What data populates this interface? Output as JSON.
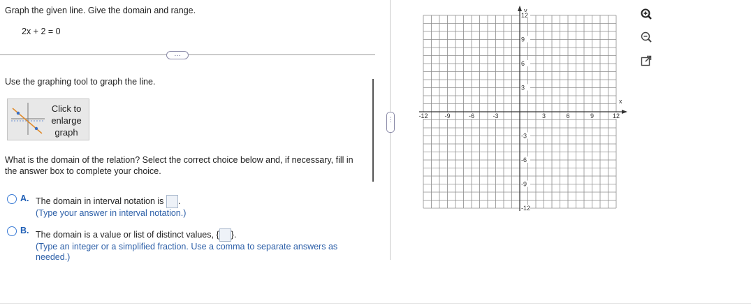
{
  "question": {
    "prompt": "Graph the given line. Give the domain and range.",
    "equation": "2x + 2 = 0"
  },
  "instructions": "Use the graphing tool to graph the line.",
  "enlarge": {
    "line1": "Click to",
    "line2": "enlarge",
    "line3": "graph"
  },
  "more_button": "…",
  "divider_handle": "⋮",
  "domain_question": {
    "line1": "What is the domain of the relation? Select the correct choice below and, if necessary, fill in",
    "line2": "the answer box to complete your choice."
  },
  "choices": [
    {
      "letter": "A.",
      "text_before": "The domain in interval notation is",
      "text_after": ".",
      "hint": "(Type your answer in interval notation.)"
    },
    {
      "letter": "B.",
      "text_before": "The domain is a value or list of distinct values,",
      "open_brace": "{",
      "close_brace": "}",
      "text_after": ".",
      "hint_line1": "(Type an integer or a simplified fraction. Use a comma to separate answers as",
      "hint_line2": "needed.)"
    }
  ],
  "graph": {
    "x_axis_label": "x",
    "y_axis_label": "y",
    "x_ticks": [
      "-12",
      "-9",
      "-6",
      "-3",
      "3",
      "6",
      "9",
      "12"
    ],
    "y_ticks": [
      "12",
      "9",
      "6",
      "3",
      "-3",
      "-6",
      "-9",
      "-12"
    ],
    "range": [
      -12,
      12
    ],
    "grid": true
  },
  "tools": [
    "zoom-in-icon",
    "zoom-out-icon",
    "open-new-window-icon"
  ],
  "colors": {
    "accent": "#1f5fb6",
    "grid": "#9a9a9a",
    "radio": "#3a7bd5"
  }
}
